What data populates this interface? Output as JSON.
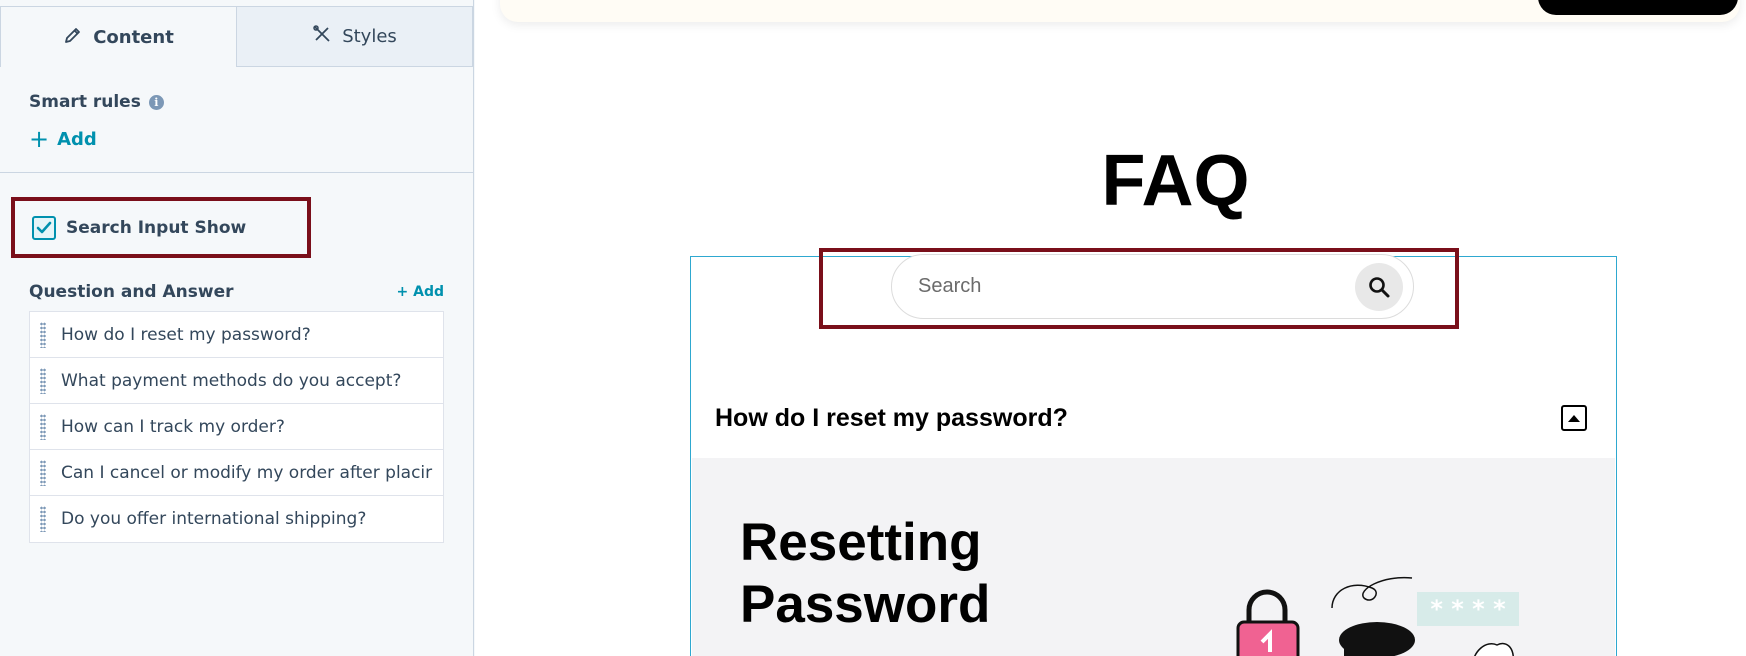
{
  "sidebar": {
    "tabs": [
      {
        "label": "Content",
        "icon": "pencil-icon",
        "active": true
      },
      {
        "label": "Styles",
        "icon": "brush-icon",
        "active": false
      }
    ],
    "smart_rules": {
      "label": "Smart rules",
      "info_icon": "info-icon",
      "add_label": "Add"
    },
    "search_toggle": {
      "label": "Search Input Show",
      "checked": true
    },
    "qa": {
      "title": "Question and Answer",
      "add_label": "+ Add",
      "items": [
        "How do I reset my password?",
        "What payment methods do you accept?",
        "How can I track my order?",
        "Can I cancel or modify my order after placir",
        "Do you offer international shipping?"
      ]
    }
  },
  "preview": {
    "title": "FAQ",
    "search": {
      "placeholder": "Search",
      "value": "",
      "icon": "search-icon"
    },
    "accordion": {
      "question": "How do I reset my password?",
      "toggle_icon": "collapse-icon",
      "answer_title_line1": "Resetting",
      "answer_title_line2": "Password",
      "illustration_text": "* * * *"
    }
  },
  "colors": {
    "accent": "#0091ae",
    "highlight": "#7a0f1a",
    "frame": "#2ea8d0",
    "lock_pink": "#f06292"
  }
}
